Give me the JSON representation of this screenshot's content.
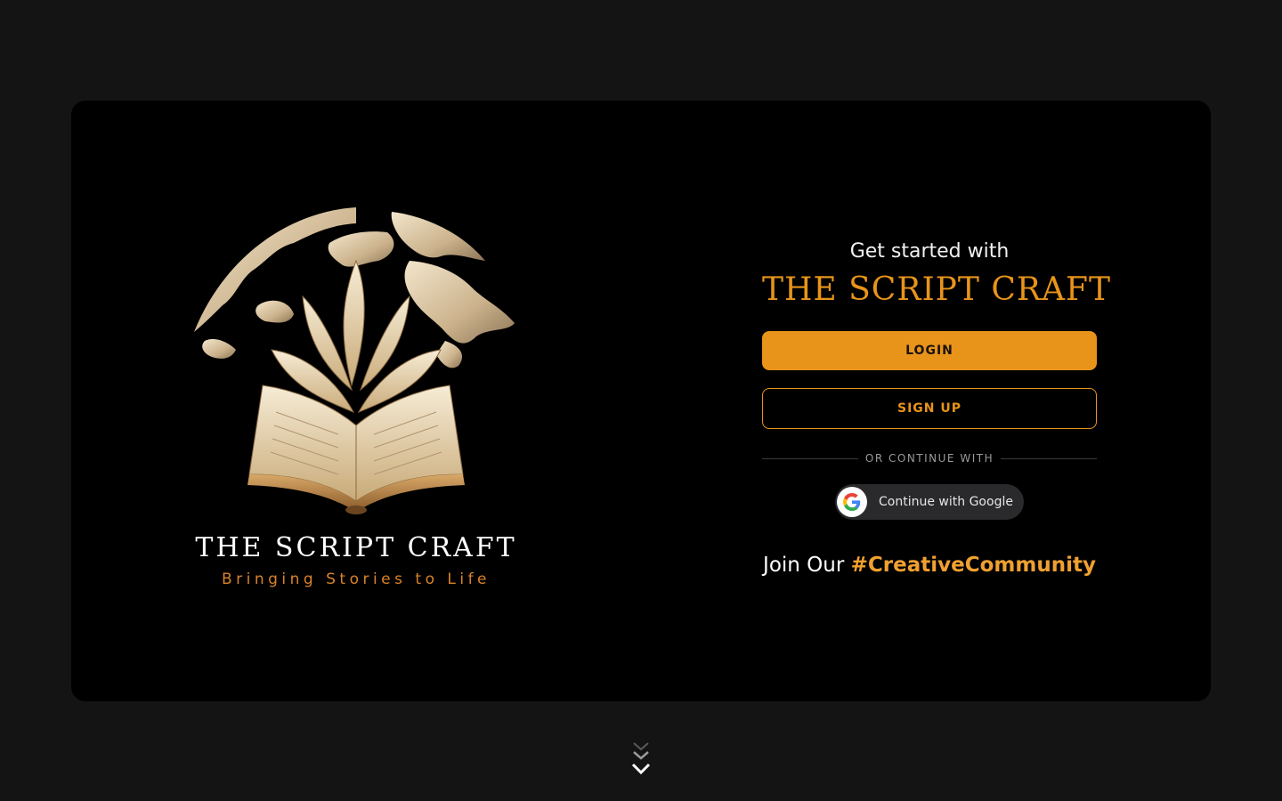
{
  "logo": {
    "title": "THE SCRIPT CRAFT",
    "tagline": "Bringing Stories to Life",
    "icon": "globe-book-icon"
  },
  "panel": {
    "heading": "Get started with",
    "brand": "THE SCRIPT CRAFT",
    "login_label": "LOGIN",
    "signup_label": "SIGN UP",
    "divider_text": "OR CONTINUE WITH",
    "google_label": "Continue with Google",
    "join_prefix": "Join Our ",
    "join_hashtag": "#CreativeCommunity"
  },
  "scroll": {
    "icon": "chevron-double-down-icon"
  },
  "colors": {
    "accent": "#e8941a",
    "background": "#141414",
    "card": "#000000"
  }
}
